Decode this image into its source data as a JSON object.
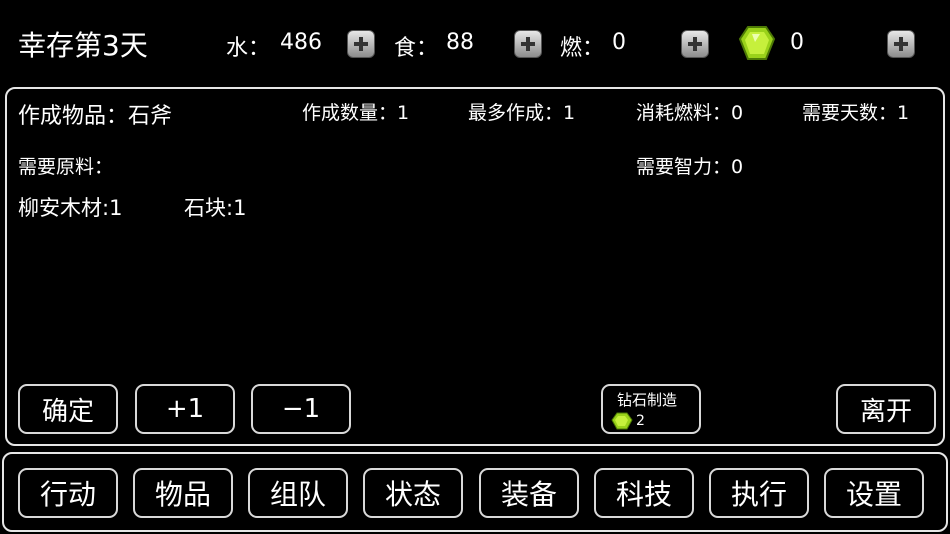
{
  "topbar": {
    "day_label": "幸存第3天",
    "water_label": "水：",
    "water_value": "486",
    "food_label": "食：",
    "food_value": "88",
    "fuel_label": "燃：",
    "fuel_value": "0",
    "gem_value": "0"
  },
  "craft": {
    "item_label": "作成物品：石斧",
    "quantity_label": "作成数量：1",
    "max_label": "最多作成：1",
    "fuel_cost_label": "消耗燃料：0",
    "days_label": "需要天数：1",
    "materials_label": "需要原料：",
    "intellect_label": "需要智力：0",
    "material_wood": "柳安木材:1",
    "material_stone": "石块:1"
  },
  "actions": {
    "confirm": "确定",
    "plus_one": "+1",
    "minus_one": "−1",
    "diamond_craft": "钻石制造",
    "diamond_cost": "2",
    "leave": "离开"
  },
  "nav": [
    "行动",
    "物品",
    "组队",
    "状态",
    "装备",
    "科技",
    "执行",
    "设置"
  ],
  "colors": {
    "gem": "#a8e020",
    "border": "#e6e6e6",
    "background": "#000000"
  }
}
